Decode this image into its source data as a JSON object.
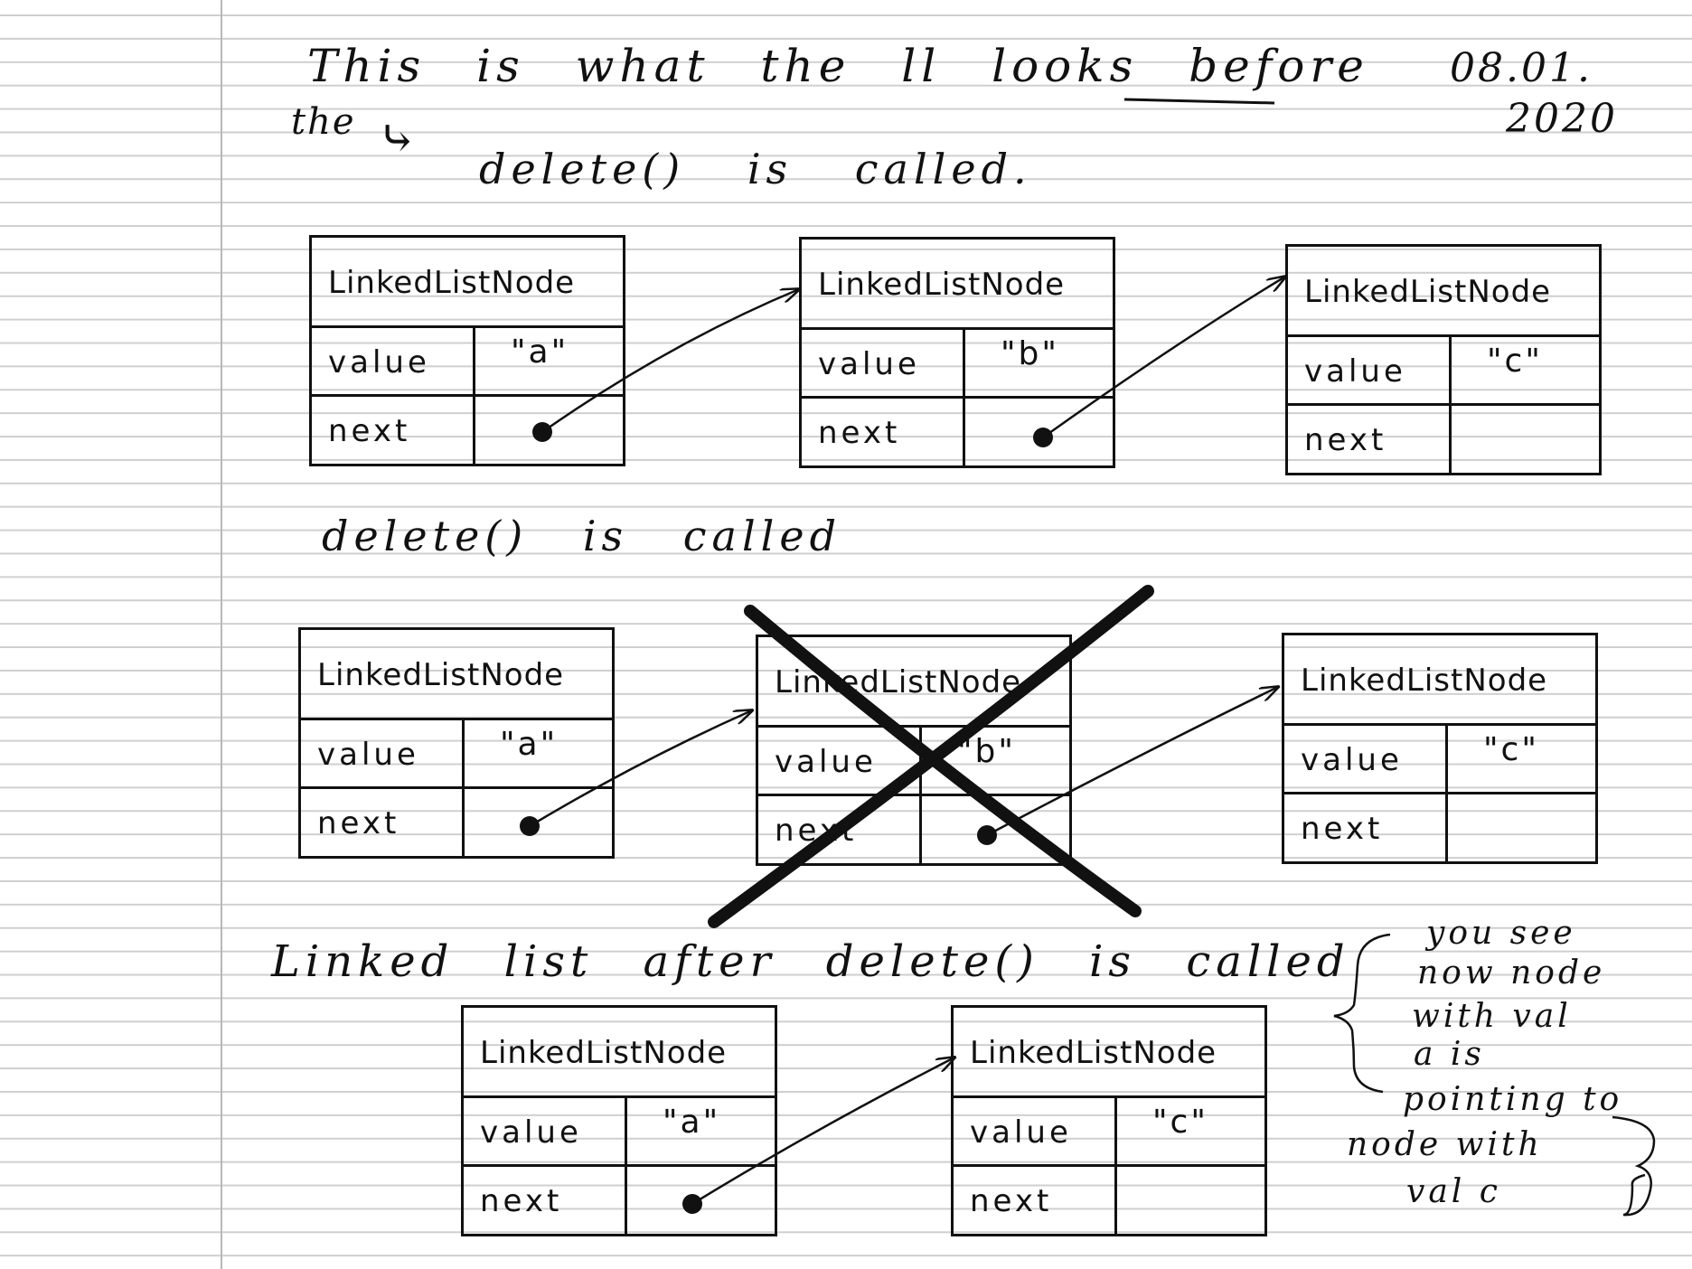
{
  "heading": {
    "line1": "This is what the ll looks before",
    "the_word": "the",
    "arrow": "⤷",
    "line2": "delete() is called."
  },
  "date": {
    "line1": "08.01.",
    "line2": "2020"
  },
  "section2_title": "delete() is called",
  "section3_title": "Linked list after delete() is called",
  "node_labels": {
    "header": "LinkedListNode",
    "value": "value",
    "next": "next"
  },
  "rows": {
    "before": [
      {
        "value": "\"a\""
      },
      {
        "value": "\"b\""
      },
      {
        "value": "\"c\""
      }
    ],
    "during": [
      {
        "value": "\"a\""
      },
      {
        "value": "\"b\""
      },
      {
        "value": "\"c\""
      }
    ],
    "after": [
      {
        "value": "\"a\""
      },
      {
        "value": "\"c\""
      }
    ]
  },
  "note": {
    "lines": [
      "you see",
      "now node",
      "with val",
      "a is",
      "pointing to",
      "node with",
      "val c"
    ]
  },
  "colors": {
    "ink": "#111111",
    "ruled_line": "#cfcfcf",
    "margin_line": "#b8b8b8"
  }
}
